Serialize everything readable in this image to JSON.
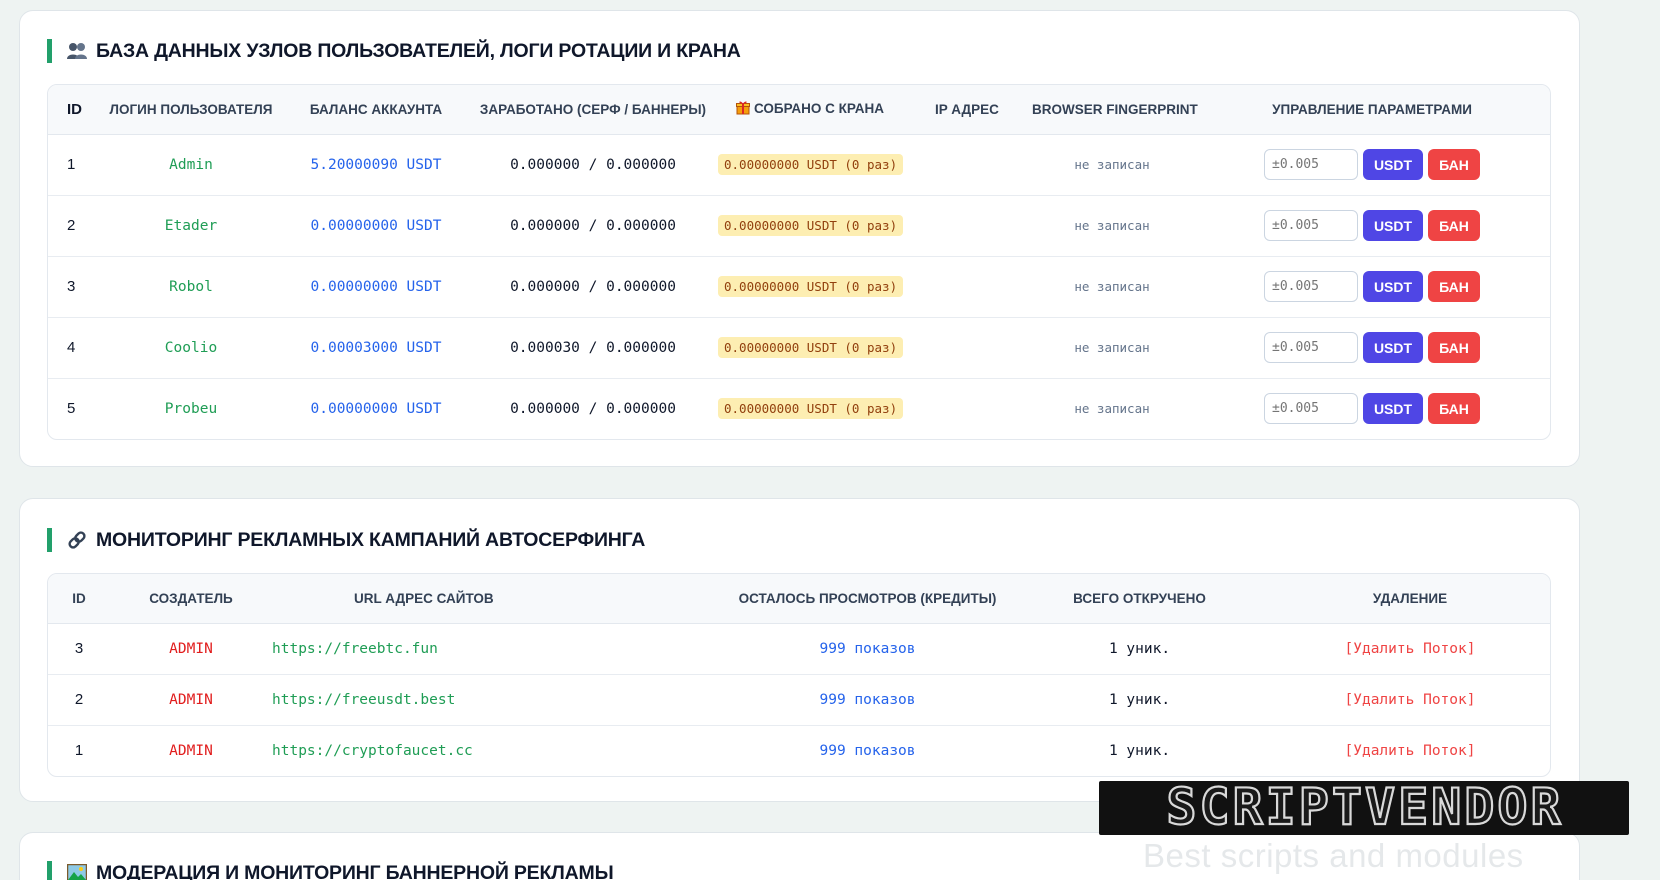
{
  "users_section": {
    "title": "БАЗА ДАННЫХ УЗЛОВ ПОЛЬЗОВАТЕЛЕЙ, ЛОГИ РОТАЦИИ И КРАНА",
    "icon": "users-icon",
    "columns": {
      "id": "ID",
      "login": "ЛОГИН ПОЛЬЗОВАТЕЛЯ",
      "balance": "БАЛАНС АККАУНТА",
      "earned": "ЗАРАБОТАНО (СЕРФ / БАННЕРЫ)",
      "faucet": "СОБРАНО С КРАНА",
      "ip": "IP АДРЕС",
      "fingerprint": "BROWSER FINGERPRINT",
      "manage": "УПРАВЛЕНИЕ ПАРАМЕТРАМИ"
    },
    "faucet_icon": "gift-icon",
    "rows": [
      {
        "id": "1",
        "login": "Admin",
        "balance": "5.20000090 USDT",
        "earned": "0.000000 / 0.000000",
        "faucet": "0.00000000 USDT (0 раз)",
        "ip": "",
        "fingerprint": "не записан",
        "amount_placeholder": "±0.005",
        "usdt_label": "USDT",
        "ban_label": "БАН"
      },
      {
        "id": "2",
        "login": "Etader",
        "balance": "0.00000000 USDT",
        "earned": "0.000000 / 0.000000",
        "faucet": "0.00000000 USDT (0 раз)",
        "ip": "",
        "fingerprint": "не записан",
        "amount_placeholder": "±0.005",
        "usdt_label": "USDT",
        "ban_label": "БАН"
      },
      {
        "id": "3",
        "login": "Robol",
        "balance": "0.00000000 USDT",
        "earned": "0.000000 / 0.000000",
        "faucet": "0.00000000 USDT (0 раз)",
        "ip": "",
        "fingerprint": "не записан",
        "amount_placeholder": "±0.005",
        "usdt_label": "USDT",
        "ban_label": "БАН"
      },
      {
        "id": "4",
        "login": "Coolio",
        "balance": "0.00003000 USDT",
        "earned": "0.000030 / 0.000000",
        "faucet": "0.00000000 USDT (0 раз)",
        "ip": "",
        "fingerprint": "не записан",
        "amount_placeholder": "±0.005",
        "usdt_label": "USDT",
        "ban_label": "БАН"
      },
      {
        "id": "5",
        "login": "Probeu",
        "balance": "0.00000000 USDT",
        "earned": "0.000000 / 0.000000",
        "faucet": "0.00000000 USDT (0 раз)",
        "ip": "",
        "fingerprint": "не записан",
        "amount_placeholder": "±0.005",
        "usdt_label": "USDT",
        "ban_label": "БАН"
      }
    ]
  },
  "campaigns_section": {
    "title": "МОНИТОРИНГ РЕКЛАМНЫХ КАМПАНИЙ АВТОСЕРФИНГА",
    "icon": "link-icon",
    "columns": {
      "id": "ID",
      "creator": "СОЗДАТЕЛЬ",
      "url": "URL АДРЕС САЙТОВ",
      "remaining": "ОСТАЛОСЬ ПРОСМОТРОВ (КРЕДИТЫ)",
      "total": "ВСЕГО ОТКРУЧЕНО",
      "delete": "УДАЛЕНИЕ"
    },
    "rows": [
      {
        "id": "3",
        "creator": "ADMIN",
        "url": "https://freebtc.fun",
        "remaining": "999 показов",
        "total": "1 уник.",
        "delete_label": "[Удалить Поток]"
      },
      {
        "id": "2",
        "creator": "ADMIN",
        "url": "https://freeusdt.best",
        "remaining": "999 показов",
        "total": "1 уник.",
        "delete_label": "[Удалить Поток]"
      },
      {
        "id": "1",
        "creator": "ADMIN",
        "url": "https://cryptofaucet.cc",
        "remaining": "999 показов",
        "total": "1 уник.",
        "delete_label": "[Удалить Поток]"
      }
    ]
  },
  "banners_section": {
    "title": "МОДЕРАЦИЯ И МОНИТОРИНГ БАННЕРНОЙ РЕКЛАМЫ",
    "icon": "picture-icon"
  },
  "watermark": {
    "logo": "SCRIPTVENDOR",
    "tagline": "Best scripts and modules"
  },
  "colors": {
    "accent_green": "#22a06b",
    "login_green": "#1f9d55",
    "balance_blue": "#2563eb",
    "usdt_button": "#4f46e5",
    "ban_button": "#ef4444",
    "creator_red": "#e11d1d",
    "faucet_badge_bg": "#fdeeb2"
  }
}
